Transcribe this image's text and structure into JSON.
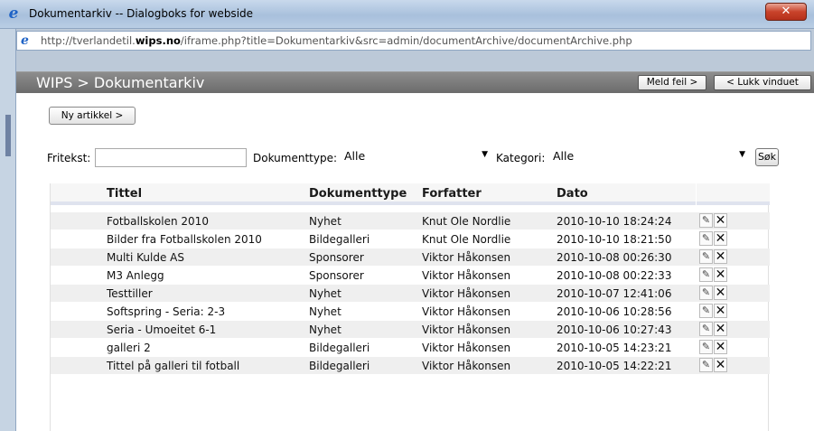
{
  "window": {
    "title": "Dokumentarkiv -- Dialogboks for webside",
    "close_label": "✕"
  },
  "address": {
    "url_prefix": "http://tverlandetil.",
    "url_domain": "wips.no",
    "url_suffix": "/iframe.php?title=Dokumentarkiv&src=admin/documentArchive/documentArchive.php"
  },
  "header": {
    "title": "WIPS > Dokumentarkiv",
    "report_label": "Meld feil >",
    "close_label": "< Lukk vinduet"
  },
  "toolbar": {
    "new_article_label": "Ny artikkel >"
  },
  "filters": {
    "freetext_label": "Fritekst:",
    "freetext_value": "",
    "doctype_label": "Dokumenttype:",
    "doctype_value": "Alle",
    "category_label": "Kategori:",
    "category_value": "Alle",
    "search_label": "Søk"
  },
  "table": {
    "columns": [
      "Tittel",
      "Dokumenttype",
      "Forfatter",
      "Dato"
    ],
    "rows": [
      [
        "Fotballskolen 2010",
        "Nyhet",
        "Knut Ole Nordlie",
        "2010-10-10 18:24:24"
      ],
      [
        "Bilder fra Fotballskolen 2010",
        "Bildegalleri",
        "Knut Ole Nordlie",
        "2010-10-10 18:21:50"
      ],
      [
        "Multi Kulde AS",
        "Sponsorer",
        "Viktor Håkonsen",
        "2010-10-08 00:26:30"
      ],
      [
        "M3 Anlegg",
        "Sponsorer",
        "Viktor Håkonsen",
        "2010-10-08 00:22:33"
      ],
      [
        "Testtiller",
        "Nyhet",
        "Viktor Håkonsen",
        "2010-10-07 12:41:06"
      ],
      [
        "Softspring - Seria: 2-3",
        "Nyhet",
        "Viktor Håkonsen",
        "2010-10-06 10:28:56"
      ],
      [
        "Seria - Umoeitet 6-1",
        "Nyhet",
        "Viktor Håkonsen",
        "2010-10-06 10:27:43"
      ],
      [
        "galleri 2",
        "Bildegalleri",
        "Viktor Håkonsen",
        "2010-10-05 14:23:21"
      ],
      [
        "Tittel på galleri til fotball",
        "Bildegalleri",
        "Viktor Håkonsen",
        "2010-10-05 14:22:21"
      ]
    ]
  }
}
